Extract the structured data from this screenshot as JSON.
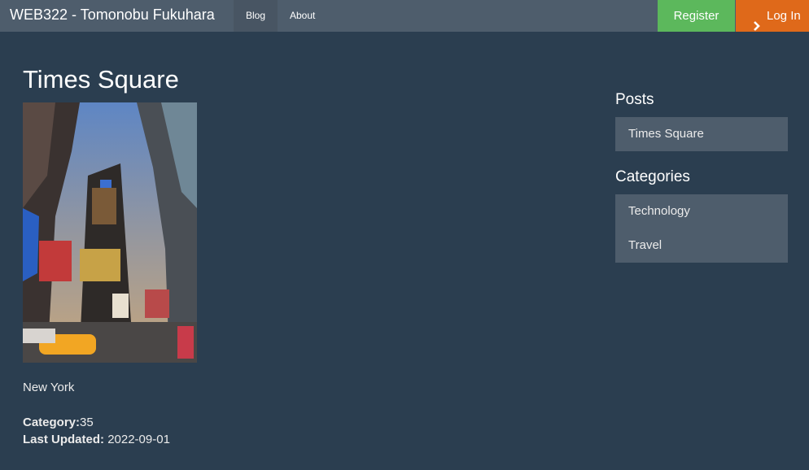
{
  "navbar": {
    "brand": "WEB322 - Tomonobu Fukuhara",
    "links": [
      "Blog",
      "About"
    ],
    "register": "Register",
    "login": "Log In"
  },
  "post": {
    "title": "Times Square",
    "body": "New York",
    "category_label": "Category:",
    "category_value": "35",
    "updated_label": "Last Updated:",
    "updated_value": "2022-09-01"
  },
  "sidebar": {
    "posts_heading": "Posts",
    "posts": [
      "Times Square"
    ],
    "categories_heading": "Categories",
    "categories": [
      "Technology",
      "Travel"
    ]
  },
  "colors": {
    "background": "#2b3e50",
    "navbar": "#4e5d6c",
    "register": "#5cb85c",
    "login": "#df691a"
  }
}
